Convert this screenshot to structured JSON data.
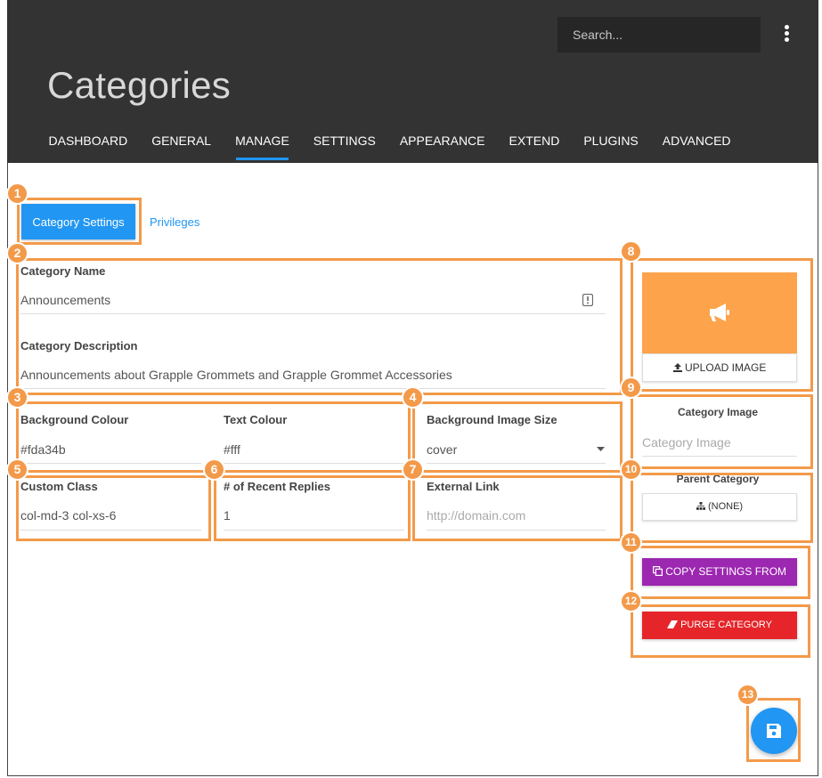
{
  "header": {
    "search_placeholder": "Search...",
    "title": "Categories",
    "tabs": [
      {
        "label": "DASHBOARD"
      },
      {
        "label": "GENERAL"
      },
      {
        "label": "MANAGE",
        "active": true
      },
      {
        "label": "SETTINGS"
      },
      {
        "label": "APPEARANCE"
      },
      {
        "label": "EXTEND"
      },
      {
        "label": "PLUGINS"
      },
      {
        "label": "ADVANCED"
      }
    ]
  },
  "subtabs": {
    "category_settings": "Category Settings",
    "privileges": "Privileges"
  },
  "form": {
    "name_label": "Category Name",
    "name_value": "Announcements",
    "description_label": "Category Description",
    "description_value": "Announcements about Grapple Grommets and Grapple Grommet Accessories",
    "bg_colour_label": "Background Colour",
    "bg_colour_value": "#fda34b",
    "text_colour_label": "Text Colour",
    "text_colour_value": "#fff",
    "bg_image_size_label": "Background Image Size",
    "bg_image_size_value": "cover",
    "custom_class_label": "Custom Class",
    "custom_class_value": "col-md-3 col-xs-6",
    "recent_replies_label": "# of Recent Replies",
    "recent_replies_value": "1",
    "external_link_label": "External Link",
    "external_link_placeholder": "http://domain.com"
  },
  "sidebar": {
    "icon_tile_color": "#fda34b",
    "upload_label": "UPLOAD IMAGE",
    "category_image_title": "Category Image",
    "category_image_placeholder": "Category Image",
    "parent_category_title": "Parent Category",
    "parent_category_value": "(NONE)",
    "copy_settings_label": "COPY SETTINGS FROM",
    "purge_label": "PURGE CATEGORY"
  },
  "annotations": [
    "1",
    "2",
    "3",
    "4",
    "5",
    "6",
    "7",
    "8",
    "9",
    "10",
    "11",
    "12",
    "13"
  ],
  "colors": {
    "accent": "#2196f3",
    "header_bg": "#333333",
    "annotation": "#f39a4a",
    "copy_button": "#9c27b0",
    "purge_button": "#e5252a"
  }
}
